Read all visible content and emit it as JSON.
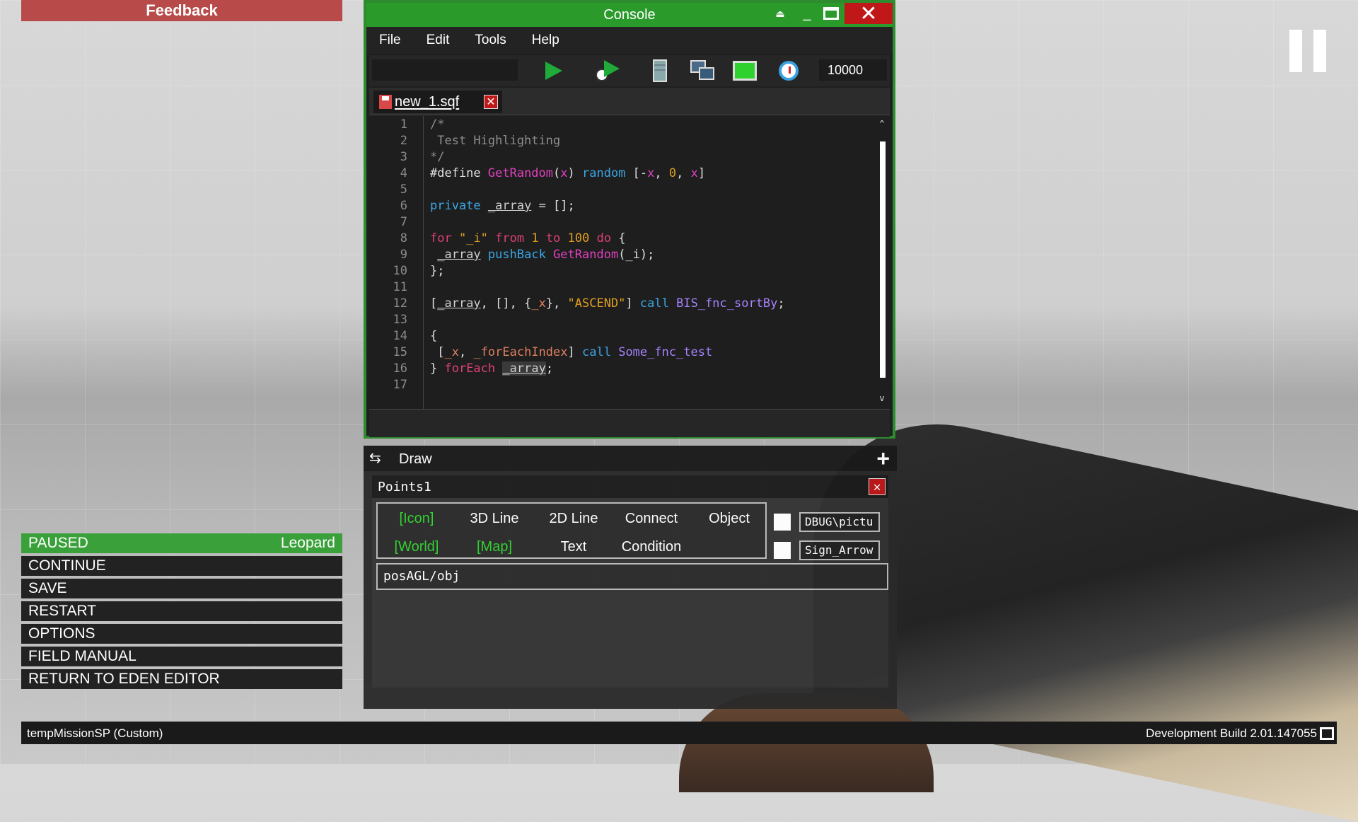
{
  "feedback_label": "Feedback",
  "console": {
    "title": "Console",
    "menu": [
      "File",
      "Edit",
      "Tools",
      "Help"
    ],
    "toolbar": {
      "icons": [
        "run-icon",
        "timed-run-icon",
        "server-icon",
        "remote-exec-icon",
        "monitor-icon",
        "stopwatch-icon"
      ],
      "count_value": "10000"
    },
    "tab": {
      "name": "new_1.sqf"
    },
    "line_numbers": [
      "1",
      "2",
      "3",
      "4",
      "5",
      "6",
      "7",
      "8",
      "9",
      "10",
      "11",
      "12",
      "13",
      "14",
      "15",
      "16",
      "17"
    ],
    "code": [
      [
        [
          "k-cm",
          "/*"
        ]
      ],
      [
        [
          "k-cm",
          " Test Highlighting"
        ]
      ],
      [
        [
          "k-cm",
          "*/"
        ]
      ],
      [
        [
          "k-pl",
          "#define "
        ],
        [
          "k-macro",
          "GetRandom"
        ],
        [
          "k-pl",
          "("
        ],
        [
          "k-macro",
          "x"
        ],
        [
          "k-pl",
          ") "
        ],
        [
          "k-cmd",
          "random"
        ],
        [
          "k-pl",
          " ["
        ],
        [
          "k-pl",
          "-"
        ],
        [
          "k-macro",
          "x"
        ],
        [
          "k-pl",
          ", "
        ],
        [
          "k-num",
          "0"
        ],
        [
          "k-pl",
          ", "
        ],
        [
          "k-macro",
          "x"
        ],
        [
          "k-pl",
          "]"
        ]
      ],
      [],
      [
        [
          "k-cmd",
          "private"
        ],
        [
          "k-pl",
          " "
        ],
        [
          "k-var",
          "_array"
        ],
        [
          "k-pl",
          " = [];"
        ]
      ],
      [],
      [
        [
          "k-kw",
          "for"
        ],
        [
          "k-pl",
          " "
        ],
        [
          "k-str",
          "\"_i\""
        ],
        [
          "k-pl",
          " "
        ],
        [
          "k-kw",
          "from"
        ],
        [
          "k-pl",
          " "
        ],
        [
          "k-num",
          "1"
        ],
        [
          "k-pl",
          " "
        ],
        [
          "k-kw",
          "to"
        ],
        [
          "k-pl",
          " "
        ],
        [
          "k-num",
          "100"
        ],
        [
          "k-pl",
          " "
        ],
        [
          "k-kw",
          "do"
        ],
        [
          "k-pl",
          " {"
        ]
      ],
      [
        [
          "k-pl",
          " "
        ],
        [
          "k-var",
          "_array"
        ],
        [
          "k-pl",
          " "
        ],
        [
          "k-cmd",
          "pushBack"
        ],
        [
          "k-pl",
          " "
        ],
        [
          "k-macro",
          "GetRandom"
        ],
        [
          "k-pl",
          "(_i);"
        ]
      ],
      [
        [
          "k-pl",
          "};"
        ]
      ],
      [],
      [
        [
          "k-pl",
          "["
        ],
        [
          "k-var",
          "_array"
        ],
        [
          "k-pl",
          ", [], {"
        ],
        [
          "k-lvar",
          "_x"
        ],
        [
          "k-pl",
          "}, "
        ],
        [
          "k-str",
          "\"ASCEND\""
        ],
        [
          "k-pl",
          "] "
        ],
        [
          "k-cmd",
          "call"
        ],
        [
          "k-pl",
          " "
        ],
        [
          "k-fn",
          "BIS_fnc_sortBy"
        ],
        [
          "k-pl",
          ";"
        ]
      ],
      [],
      [
        [
          "k-pl",
          "{"
        ]
      ],
      [
        [
          "k-pl",
          " ["
        ],
        [
          "k-lvar",
          "_x"
        ],
        [
          "k-pl",
          ", "
        ],
        [
          "k-lvar",
          "_forEachIndex"
        ],
        [
          "k-pl",
          "] "
        ],
        [
          "k-cmd",
          "call"
        ],
        [
          "k-pl",
          " "
        ],
        [
          "k-fn",
          "Some_fnc_test"
        ]
      ],
      [
        [
          "k-pl",
          "} "
        ],
        [
          "k-kw",
          "forEach"
        ],
        [
          "k-pl",
          " "
        ],
        [
          "k-var k-hl",
          "_array"
        ],
        [
          "k-pl",
          ";"
        ]
      ],
      []
    ]
  },
  "draw": {
    "title": "Draw",
    "points": {
      "title": "Points1",
      "modes_row1": [
        {
          "label": "[Icon]",
          "active": true
        },
        {
          "label": "3D Line",
          "active": false
        },
        {
          "label": "2D Line",
          "active": false
        },
        {
          "label": "Connect",
          "active": false
        },
        {
          "label": "Object",
          "active": false
        }
      ],
      "modes_row2": [
        {
          "label": "[World]",
          "active": true
        },
        {
          "label": "[Map]",
          "active": true
        },
        {
          "label": "Text",
          "active": false
        },
        {
          "label": "Condition",
          "active": false
        }
      ],
      "texture1": "DBUG\\pictu",
      "texture2": "Sign_Arrow",
      "position": "posAGL/obj"
    }
  },
  "pause_menu": {
    "status": "PAUSED",
    "player": "Leopard",
    "items": [
      "CONTINUE",
      "SAVE",
      "RESTART",
      "OPTIONS",
      "FIELD MANUAL",
      "RETURN TO EDEN EDITOR"
    ]
  },
  "status_bar": {
    "mission": "tempMissionSP (Custom)",
    "build": "Development Build 2.01.147055"
  }
}
